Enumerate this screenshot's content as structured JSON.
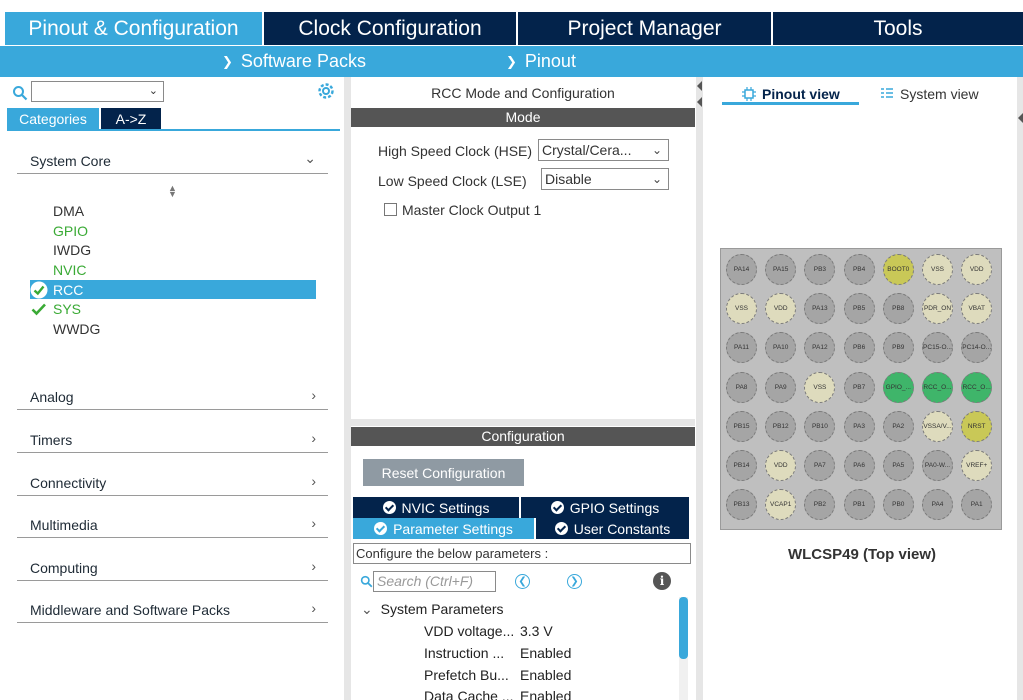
{
  "top_tabs": [
    {
      "label": "Pinout & Configuration",
      "active": true
    },
    {
      "label": "Clock Configuration",
      "active": false
    },
    {
      "label": "Project Manager",
      "active": false
    },
    {
      "label": "Tools",
      "active": false
    }
  ],
  "sub_menu": [
    {
      "label": "Software Packs"
    },
    {
      "label": "Pinout"
    }
  ],
  "left_panel": {
    "category_tabs": {
      "categories": "Categories",
      "az": "A->Z"
    },
    "system_core": {
      "label": "System Core"
    },
    "core_items": [
      {
        "label": "DMA",
        "state": "normal"
      },
      {
        "label": "GPIO",
        "state": "green"
      },
      {
        "label": "IWDG",
        "state": "normal"
      },
      {
        "label": "NVIC",
        "state": "green"
      },
      {
        "label": "RCC",
        "state": "selected"
      },
      {
        "label": "SYS",
        "state": "checked"
      },
      {
        "label": "WWDG",
        "state": "normal"
      }
    ],
    "sections": [
      {
        "label": "Analog"
      },
      {
        "label": "Timers"
      },
      {
        "label": "Connectivity"
      },
      {
        "label": "Multimedia"
      },
      {
        "label": "Computing"
      },
      {
        "label": "Middleware and Software Packs"
      }
    ]
  },
  "mode_panel": {
    "title": "RCC Mode and Configuration",
    "mode_header": "Mode",
    "hse_label": "High Speed Clock (HSE)",
    "hse_value": "Crystal/Cera...",
    "lse_label": "Low Speed Clock (LSE)",
    "lse_value": "Disable",
    "mco_label": "Master Clock Output 1",
    "mco_checked": false
  },
  "config_panel": {
    "header": "Configuration",
    "reset_button": "Reset Configuration",
    "tabs": [
      {
        "label": "NVIC Settings",
        "active": false
      },
      {
        "label": "GPIO Settings",
        "active": false
      },
      {
        "label": "Parameter Settings",
        "active": true
      },
      {
        "label": "User Constants",
        "active": false
      }
    ],
    "configure_text": "Configure the below parameters :",
    "search_placeholder": "Search (Ctrl+F)",
    "group_label": "System Parameters",
    "params": [
      {
        "name": "VDD voltage...",
        "value": "3.3 V"
      },
      {
        "name": "Instruction ...",
        "value": "Enabled"
      },
      {
        "name": "Prefetch Bu...",
        "value": "Enabled"
      },
      {
        "name": "Data Cache ...",
        "value": "Enabled"
      }
    ]
  },
  "right_panel": {
    "pinout_view": "Pinout view",
    "system_view": "System view",
    "package_name": "WLCSP49 (Top view)",
    "pins": [
      [
        "PA14",
        "PA15",
        "PB3",
        "PB4",
        "BOOT0",
        "VSS",
        "VDD"
      ],
      [
        "VSS",
        "VDD",
        "PA13",
        "PB5",
        "PB8",
        "PDR_ON",
        "VBAT"
      ],
      [
        "PA11",
        "PA10",
        "PA12",
        "PB6",
        "PB9",
        "PC15-O...",
        "PC14-O..."
      ],
      [
        "PA8",
        "PA9",
        "VSS",
        "PB7",
        "GPIO_...",
        "RCC_O...",
        "RCC_O..."
      ],
      [
        "PB15",
        "PB12",
        "PB10",
        "PA3",
        "PA2",
        "VSSA/V...",
        "NRST"
      ],
      [
        "PB14",
        "VDD",
        "PA7",
        "PA6",
        "PA5",
        "PA0-W...",
        "VREF+"
      ],
      [
        "PB13",
        "VCAP1",
        "PB2",
        "PB1",
        "PB0",
        "PA4",
        "PA1"
      ]
    ],
    "pin_colors": [
      [
        "g",
        "g",
        "g",
        "g",
        "y",
        "b",
        "b"
      ],
      [
        "b",
        "b",
        "g",
        "g",
        "g",
        "b",
        "b"
      ],
      [
        "g",
        "g",
        "g",
        "g",
        "g",
        "g",
        "g"
      ],
      [
        "g",
        "g",
        "b",
        "g",
        "G",
        "G",
        "G"
      ],
      [
        "g",
        "g",
        "g",
        "g",
        "g",
        "b",
        "y"
      ],
      [
        "g",
        "b",
        "g",
        "g",
        "g",
        "g",
        "b"
      ],
      [
        "g",
        "b",
        "g",
        "g",
        "g",
        "g",
        "g"
      ]
    ]
  },
  "colors": {
    "navy": "#03234b",
    "accent": "#39a8db",
    "green_text": "#3aaa35",
    "pin_gray": "#a5a5a5",
    "pin_beige": "#dedbbd",
    "pin_yellow": "#c9c857",
    "pin_green": "#3fb56a"
  }
}
